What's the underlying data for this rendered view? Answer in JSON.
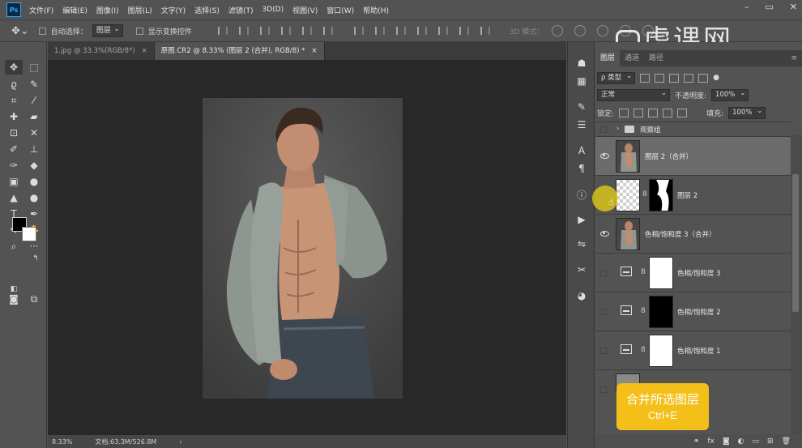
{
  "menubar": {
    "logo": "Ps",
    "items": [
      "文件(F)",
      "编辑(E)",
      "图像(I)",
      "图层(L)",
      "文字(Y)",
      "选择(S)",
      "滤镜(T)",
      "3D(D)",
      "视图(V)",
      "窗口(W)",
      "帮助(H)"
    ]
  },
  "options": {
    "auto_select": "自动选择：",
    "target": "图层",
    "show_transform": "显示变换控件",
    "mode3d": "3D 模式："
  },
  "tabs": [
    {
      "label": "1.jpg @ 33.3%(RGB/8*)",
      "close": "×"
    },
    {
      "label": "原图.CR2 @ 8.33% (图层 2 (合并), RGB/8) *",
      "close": "×"
    }
  ],
  "status": {
    "zoom": "8.33%",
    "doc": "文档:63.3M/526.8M",
    "arrow": "›"
  },
  "panel": {
    "tabs": [
      "图层",
      "通道",
      "路径"
    ],
    "filter": "ρ 类型",
    "blend": "正常",
    "opacity_label": "不透明度:",
    "opacity": "100%",
    "lock_label": "锁定:",
    "fill_label": "填充:",
    "fill": "100%"
  },
  "layers": [
    {
      "name": "观察组",
      "visible": false,
      "type": "group"
    },
    {
      "name": "图层 2（合并）",
      "visible": true,
      "type": "photo",
      "selected": true
    },
    {
      "name": "图层 2",
      "visible": false,
      "type": "masked"
    },
    {
      "name": "色相/饱和度 3（合并）",
      "visible": true,
      "type": "photo"
    },
    {
      "name": "色相/饱和度 3",
      "visible": false,
      "type": "adjust",
      "mask": "white"
    },
    {
      "name": "色相/饱和度 2",
      "visible": false,
      "type": "adjust",
      "mask": "black"
    },
    {
      "name": "色相/饱和度 1",
      "visible": false,
      "type": "adjust",
      "mask": "white"
    },
    {
      "name": "",
      "visible": false,
      "type": "photo-partial"
    }
  ],
  "tooltip": {
    "title": "合并所选图层",
    "shortcut": "Ctrl+E"
  },
  "watermark": "虎课网",
  "colors": {
    "accent": "#f3bf18",
    "foreground": "#000000",
    "background": "#ffffff"
  },
  "icons": {
    "tools": [
      "move-icon",
      "marquee-icon",
      "lasso-icon",
      "magic-wand-icon",
      "crop-icon",
      "eyedropper-icon",
      "healing-icon",
      "brush-icon",
      "stamp-icon",
      "history-brush-icon",
      "eraser-icon",
      "gradient-icon",
      "blur-icon",
      "dodge-icon",
      "pen-icon",
      "type-icon",
      "path-select-icon",
      "shape-icon",
      "hand-icon",
      "zoom-icon",
      "more-icon"
    ]
  }
}
